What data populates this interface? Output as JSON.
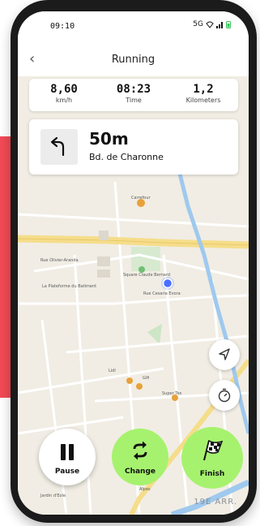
{
  "status": {
    "time": "09:10",
    "network": "5G"
  },
  "nav": {
    "title": "Running"
  },
  "stats": [
    {
      "value": "8,60",
      "label": "km/h"
    },
    {
      "value": "08:23",
      "label": "Time"
    },
    {
      "value": "1,2",
      "label": "Kilometers"
    }
  ],
  "direction": {
    "distance": "50m",
    "street": "Bd. de Charonne",
    "icon": "turn-left-arrow-icon"
  },
  "map": {
    "labels": {
      "carrefour": "Carrefour",
      "rue_olivier": "Rue Olivier-Aranda",
      "square": "Square Claude Bernard",
      "rue_cesaria": "Rue Cesaria Evora",
      "plateforme": "La Plateforme du Batiment",
      "lidl": "Lidl",
      "gifi": "Gifi",
      "super_tex": "Super Tex",
      "alpes": "Alpes",
      "jardin": "Jardin d'Eole",
      "arrondissement": "19E ARR."
    }
  },
  "actions": {
    "pause": "Pause",
    "change": "Change",
    "finish": "Finish"
  },
  "colors": {
    "accent_green": "#a6f26e",
    "red": "#f24a55",
    "route_blue": "#9fc9ee",
    "road_yellow": "#f5dd8a"
  }
}
